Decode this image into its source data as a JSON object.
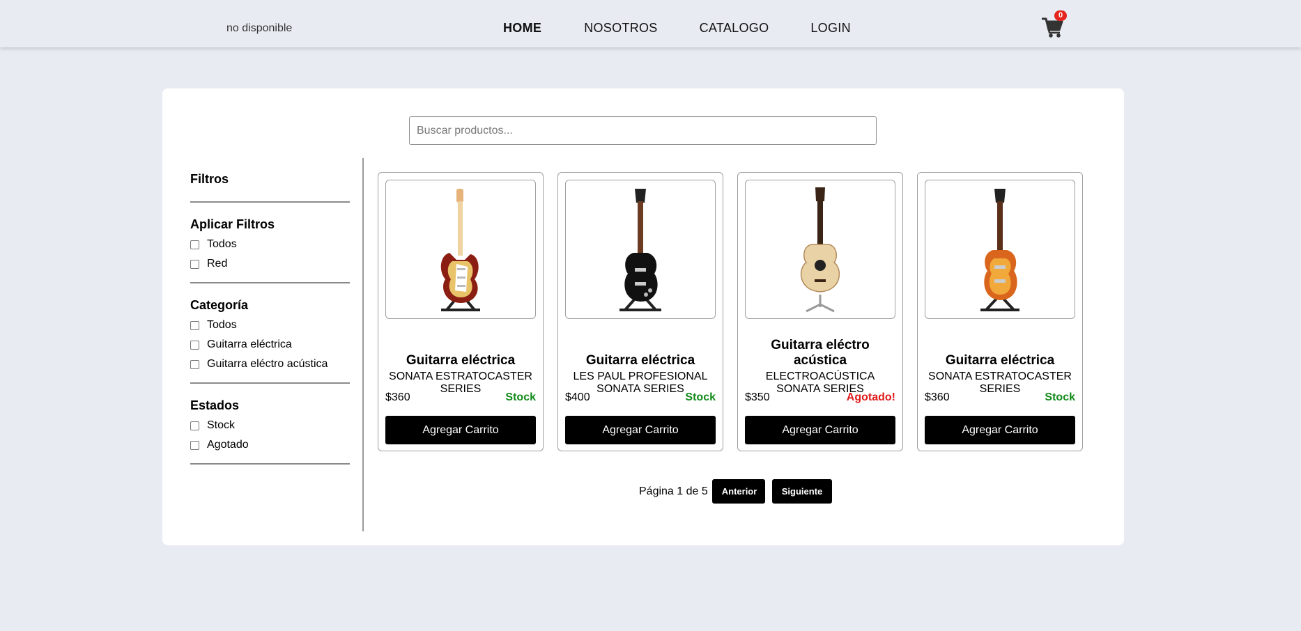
{
  "header": {
    "logo_alt": "no disponible",
    "nav": [
      "HOME",
      "NOSOTROS",
      "CATALOGO",
      "LOGIN"
    ],
    "active_nav": "HOME",
    "cart_count": "0"
  },
  "search": {
    "placeholder": "Buscar productos..."
  },
  "sidebar": {
    "title": "Filtros",
    "groups": [
      {
        "title": "Aplicar Filtros",
        "options": [
          "Todos",
          "Red"
        ]
      },
      {
        "title": "Categoría",
        "options": [
          "Todos",
          "Guitarra eléctrica",
          "Guitarra eléctro acústica"
        ]
      },
      {
        "title": "Estados",
        "options": [
          "Stock",
          "Agotado"
        ]
      }
    ]
  },
  "products": [
    {
      "title": "Guitarra eléctrica",
      "subtitle": "SONATA ESTRATOCASTER SERIES",
      "price": "$360",
      "status": "Stock",
      "status_color": "#138a1a",
      "button": "Agregar Carrito",
      "image_icon": "stratocaster-guitar-icon",
      "body_color": "#b7321a"
    },
    {
      "title": "Guitarra eléctrica",
      "subtitle": "LES PAUL PROFESIONAL SONATA SERIES",
      "price": "$400",
      "status": "Stock",
      "status_color": "#138a1a",
      "button": "Agregar Carrito",
      "image_icon": "les-paul-guitar-icon",
      "body_color": "#111111"
    },
    {
      "title": "Guitarra eléctro acústica",
      "subtitle": "ELECTROACÚSTICA SONATA SERIES",
      "price": "$350",
      "status": "Agotado!",
      "status_color": "#e01b1b",
      "button": "Agregar Carrito",
      "image_icon": "acoustic-guitar-icon",
      "body_color": "#e9d3a6"
    },
    {
      "title": "Guitarra eléctrica",
      "subtitle": "SONATA ESTRATOCASTER SERIES",
      "price": "$360",
      "status": "Stock",
      "status_color": "#138a1a",
      "button": "Agregar Carrito",
      "image_icon": "sunburst-guitar-icon",
      "body_color": "#d9661c"
    }
  ],
  "pager": {
    "label": "Página 1 de 5",
    "prev": "Anterior",
    "next": "Siguiente"
  }
}
